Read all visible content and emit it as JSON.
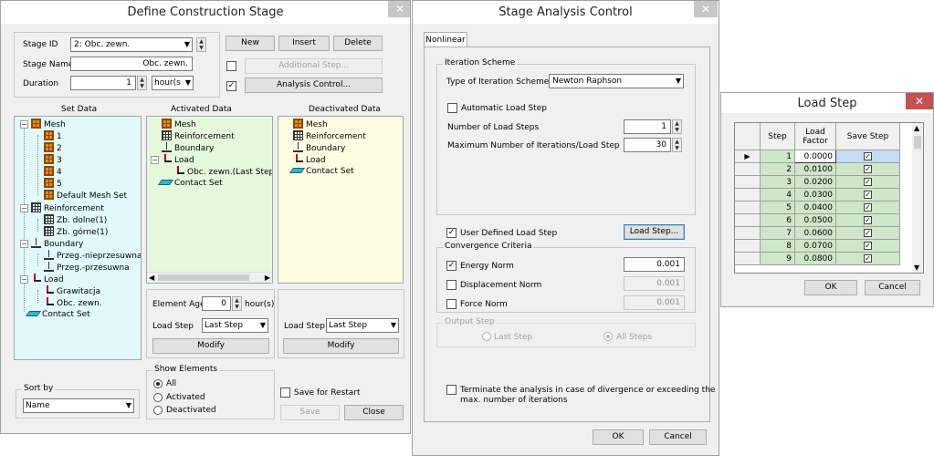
{
  "define_stage": {
    "title": "Define Construction Stage",
    "close": "✕",
    "stage_id_label": "Stage ID",
    "stage_id_value": "2: Obc. zewn.",
    "stage_name_label": "Stage Name",
    "stage_name_value": "Obc. zewn.",
    "duration_label": "Duration",
    "duration_value": "1",
    "duration_unit": "hour(s",
    "new_btn": "New",
    "insert_btn": "Insert",
    "delete_btn": "Delete",
    "additional_step_btn": "Additional Step...",
    "analysis_control_btn": "Analysis Control...",
    "set_data_header": "Set Data",
    "activated_header": "Activated Data",
    "deactivated_header": "Deactivated Data",
    "set_tree": {
      "mesh": "Mesh",
      "mesh_items": [
        "1",
        "2",
        "3",
        "4",
        "5",
        "Default Mesh Set"
      ],
      "reinforcement": "Reinforcement",
      "rein_items": [
        "Zb. dolne(1)",
        "Zb. górne(1)"
      ],
      "boundary": "Boundary",
      "bound_items": [
        "Przeg.-nieprzesuwna",
        "Przeg.-przesuwna"
      ],
      "load": "Load",
      "load_items": [
        "Grawitacja",
        "Obc. zewn."
      ],
      "contact": "Contact Set"
    },
    "activated_tree": {
      "mesh": "Mesh",
      "reinforcement": "Reinforcement",
      "boundary": "Boundary",
      "load": "Load",
      "load_item": "Obc. zewn.(Last Step)",
      "contact": "Contact Set"
    },
    "deactivated_tree": {
      "mesh": "Mesh",
      "reinforcement": "Reinforcement",
      "boundary": "Boundary",
      "load": "Load",
      "contact": "Contact Set"
    },
    "element_age_label": "Element Age",
    "element_age_value": "0",
    "element_age_unit": "hour(s)",
    "load_step_label": "Load Step",
    "load_step_value": "Last Step",
    "modify_btn": "Modify",
    "sort_by_label": "Sort by",
    "sort_by_value": "Name",
    "show_elements_label": "Show Elements",
    "show_all": "All",
    "show_activated": "Activated",
    "show_deactivated": "Deactivated",
    "save_restart_label": "Save for Restart",
    "save_btn": "Save",
    "close_btn": "Close"
  },
  "stage_analysis": {
    "title": "Stage Analysis Control",
    "close": "✕",
    "tab_nonlinear": "Nonlinear",
    "iteration_scheme_label": "Iteration Scheme",
    "type_label": "Type of Iteration Scheme",
    "type_value": "Newton Raphson",
    "auto_load_step": "Automatic Load Step",
    "num_load_steps_label": "Number of Load Steps",
    "num_load_steps_value": "1",
    "max_iter_label": "Maximum Number of Iterations/Load Step",
    "max_iter_value": "30",
    "user_defined_load_step": "User Defined Load Step",
    "load_step_btn": "Load Step...",
    "convergence_label": "Convergence Criteria",
    "energy_norm": "Energy Norm",
    "energy_norm_value": "0.001",
    "displacement_norm": "Displacement Norm",
    "displacement_norm_value": "0.001",
    "force_norm": "Force Norm",
    "force_norm_value": "0.001",
    "output_step_label": "Output Step",
    "last_step": "Last Step",
    "all_steps": "All Steps",
    "terminate_line1": "Terminate the analysis in case of divergence or exceeding the",
    "terminate_line2": "max. number of iterations",
    "ok_btn": "OK",
    "cancel_btn": "Cancel"
  },
  "load_step": {
    "title": "Load Step",
    "close": "✕",
    "col_step": "Step",
    "col_load_factor_1": "Load",
    "col_load_factor_2": "Factor",
    "col_save_step": "Save Step",
    "rows": [
      {
        "step": "1",
        "factor": "0.0000"
      },
      {
        "step": "2",
        "factor": "0.0100"
      },
      {
        "step": "3",
        "factor": "0.0200"
      },
      {
        "step": "4",
        "factor": "0.0300"
      },
      {
        "step": "5",
        "factor": "0.0400"
      },
      {
        "step": "6",
        "factor": "0.0500"
      },
      {
        "step": "7",
        "factor": "0.0600"
      },
      {
        "step": "8",
        "factor": "0.0700"
      },
      {
        "step": "9",
        "factor": "0.0800"
      }
    ],
    "ok_btn": "OK",
    "cancel_btn": "Cancel"
  }
}
